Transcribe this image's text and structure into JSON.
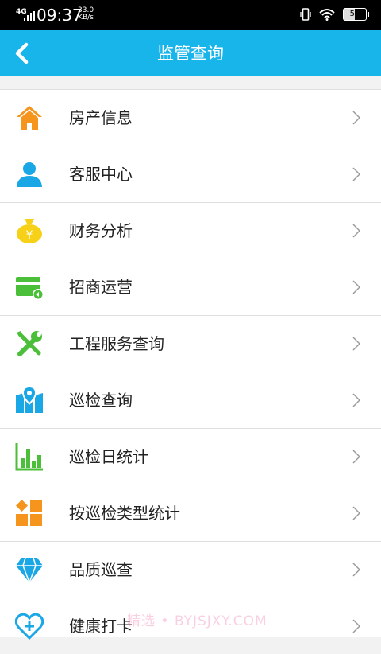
{
  "status_bar": {
    "network": "4G",
    "time": "09:37",
    "speed_value": "33.0",
    "speed_unit": "KB/s",
    "battery": "50"
  },
  "header": {
    "title": "监管查询",
    "back_icon": "chevron-left-icon"
  },
  "menu": {
    "items": [
      {
        "label": "房产信息",
        "icon": "house-icon",
        "color": "#f5951e"
      },
      {
        "label": "客服中心",
        "icon": "person-icon",
        "color": "#1aa7e6"
      },
      {
        "label": "财务分析",
        "icon": "money-bag-icon",
        "color": "#f7d117"
      },
      {
        "label": "招商运营",
        "icon": "card-icon",
        "color": "#4cbf3a"
      },
      {
        "label": "工程服务查询",
        "icon": "tools-icon",
        "color": "#4cbf3a"
      },
      {
        "label": "巡检查询",
        "icon": "map-pin-icon",
        "color": "#1aa7e6"
      },
      {
        "label": "巡检日统计",
        "icon": "bar-chart-icon",
        "color": "#4cbf3a"
      },
      {
        "label": "按巡检类型统计",
        "icon": "blocks-icon",
        "color": "#f5951e"
      },
      {
        "label": "品质巡查",
        "icon": "diamond-icon",
        "color": "#1aa7e6"
      },
      {
        "label": "健康打卡",
        "icon": "heart-plus-icon",
        "color": "#1aa7e6"
      }
    ]
  },
  "watermark": "精选 • BYJSJXY.COM"
}
